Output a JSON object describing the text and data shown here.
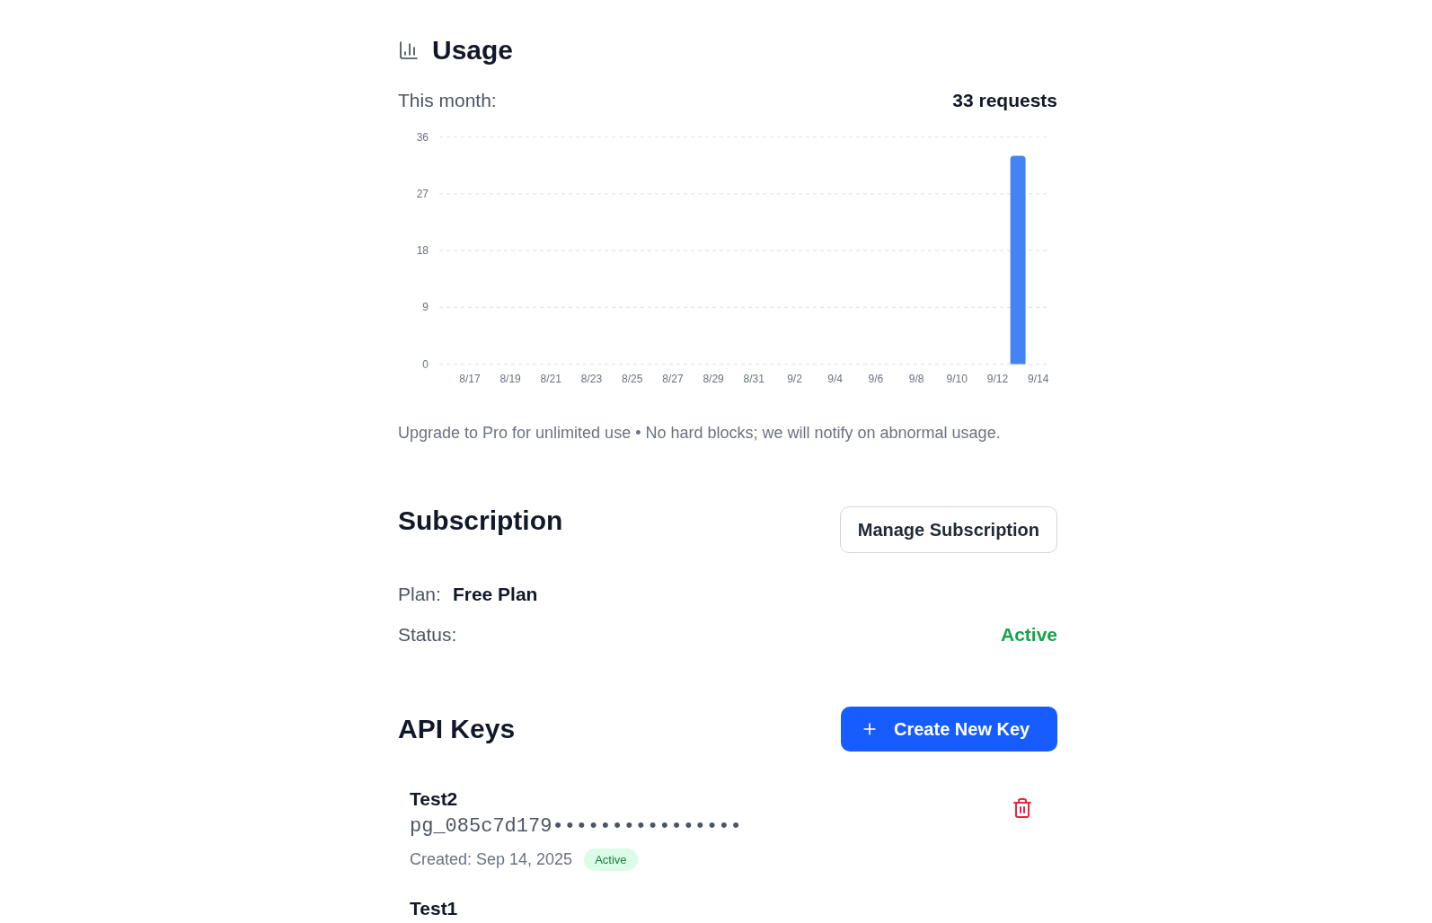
{
  "usage": {
    "title": "Usage",
    "period_label": "This month:",
    "total": "33 requests",
    "chart_data": [
      {
        "type": "bar",
        "categories": [
          null,
          "8/17",
          null,
          "8/19",
          null,
          "8/21",
          null,
          "8/23",
          null,
          "8/25",
          null,
          "8/27",
          null,
          "8/29",
          null,
          "8/31",
          null,
          "9/2",
          null,
          "9/4",
          null,
          "9/6",
          null,
          "9/8",
          null,
          "9/10",
          null,
          "9/12",
          null,
          "9/14"
        ],
        "values": [
          0,
          0,
          0,
          0,
          0,
          0,
          0,
          0,
          0,
          0,
          0,
          0,
          0,
          0,
          0,
          0,
          0,
          0,
          0,
          0,
          0,
          0,
          0,
          0,
          0,
          0,
          0,
          0,
          33,
          0
        ],
        "color": "#4483f3",
        "ylim": [
          0,
          36
        ],
        "yticks": [
          0,
          9,
          18,
          27,
          36
        ],
        "grid": true
      }
    ],
    "note": "Upgrade to Pro for unlimited use • No hard blocks; we will notify on abnormal usage."
  },
  "subscription": {
    "title": "Subscription",
    "manage_button": "Manage Subscription",
    "fields": [
      {
        "kind": "plan",
        "label": "Plan:",
        "value": "Free Plan"
      },
      {
        "kind": "status",
        "label": "Status:",
        "value": "Active"
      }
    ]
  },
  "api_keys": {
    "title": "API Keys",
    "create_button": "Create New Key",
    "keys": [
      {
        "name": "Test2",
        "key": "pg_085c7d179••••••••••••••••",
        "created": "Created: Sep 14, 2025",
        "status": "Active"
      },
      {
        "name": "Test1"
      }
    ]
  }
}
